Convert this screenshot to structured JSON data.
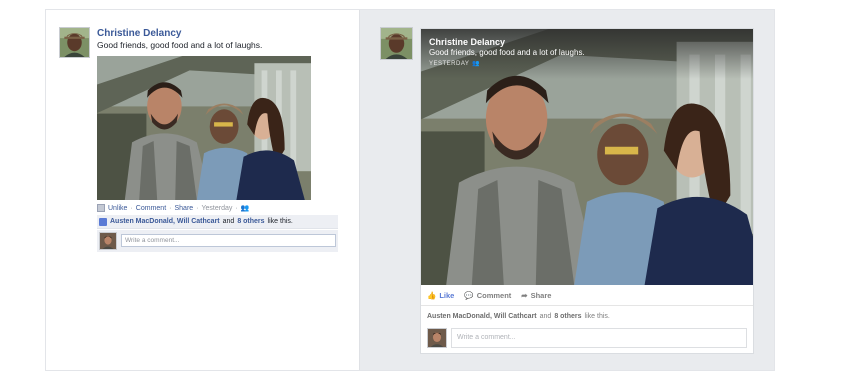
{
  "old_post": {
    "author_name": "Christine Delancy",
    "post_text": "Good friends, good food and a lot of laughs.",
    "actions": {
      "unlike": "Unlike",
      "comment": "Comment",
      "share": "Share",
      "separator": "·",
      "timestamp": "Yesterday"
    },
    "likes": {
      "names": "Austen MacDonald, Will Cathcart",
      "and": "and",
      "others": "8 others",
      "suffix": "like this."
    },
    "comment_placeholder": "Write a comment..."
  },
  "new_post": {
    "author_name": "Christine Delancy",
    "post_text": "Good friends, good food and a lot of laughs.",
    "timestamp": "YESTERDAY",
    "actions": {
      "like": "Like",
      "comment": "Comment",
      "share": "Share"
    },
    "likes": {
      "names": "Austen MacDonald, Will Cathcart",
      "and": "and",
      "others": "8 others",
      "suffix": "like this."
    },
    "comment_placeholder": "Write a comment..."
  },
  "colors": {
    "link_blue": "#3b5998",
    "like_blue": "#5b7bd5",
    "panel_gray": "#e9ebee",
    "text_gray": "#90949c"
  },
  "icons": {
    "audience": "friends-icon",
    "like": "thumbs-up-icon",
    "comment": "comment-bubble-icon",
    "share": "share-arrow-icon"
  }
}
